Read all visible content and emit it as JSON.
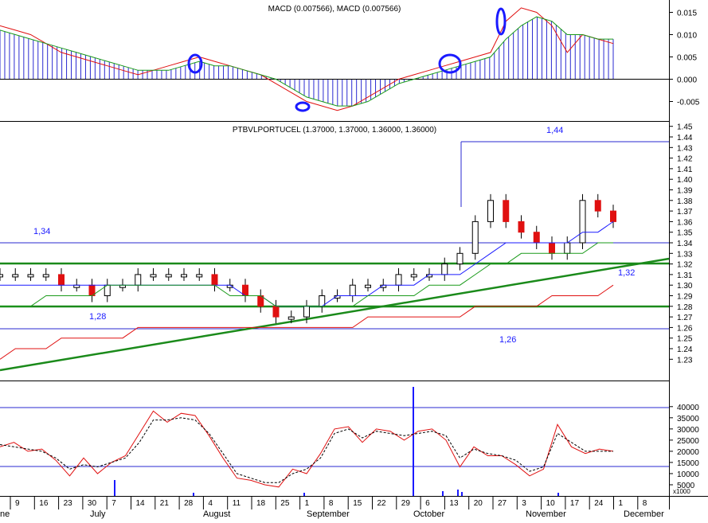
{
  "macd_panel": {
    "title": "MACD (0.007566), MACD (0.007566)",
    "axis_ticks": [
      "0.015",
      "0.010",
      "0.005",
      "0.000",
      "-0.005"
    ]
  },
  "price_panel": {
    "title": "PTBVLPORTUCEL (1.37000, 1.37000, 1.36000, 1.36000)",
    "axis_ticks": [
      "1.45",
      "1.44",
      "1.43",
      "1.42",
      "1.41",
      "1.40",
      "1.39",
      "1.38",
      "1.37",
      "1.36",
      "1.35",
      "1.34",
      "1.33",
      "1.32",
      "1.31",
      "1.30",
      "1.29",
      "1.28",
      "1.27",
      "1.26",
      "1.25",
      "1.24",
      "1.23"
    ],
    "annotations": [
      {
        "text": "1,44",
        "value": 1.44
      },
      {
        "text": "1,34",
        "value": 1.34
      },
      {
        "text": "1,32",
        "value": 1.32
      },
      {
        "text": "1,28",
        "value": 1.28
      },
      {
        "text": "1,26",
        "value": 1.26
      }
    ]
  },
  "volume_panel": {
    "axis_ticks": [
      "40000",
      "35000",
      "30000",
      "25000",
      "20000",
      "15000",
      "10000",
      "5000"
    ],
    "unit": "x1000"
  },
  "x_axis": {
    "day_ticks": [
      "9",
      "16",
      "23",
      "30",
      "7",
      "14",
      "21",
      "28",
      "4",
      "11",
      "18",
      "25",
      "1",
      "8",
      "15",
      "22",
      "29",
      "6",
      "13",
      "20",
      "27",
      "3",
      "10",
      "17",
      "24",
      "1",
      "8"
    ],
    "months": [
      "July",
      "August",
      "September",
      "October",
      "November",
      "December"
    ],
    "partial_month": "ne"
  },
  "chart_data": [
    {
      "type": "line",
      "title": "MACD (0.007566), MACD (0.007566)",
      "ylim": [
        -0.008,
        0.017
      ],
      "x_ticks": [
        "9",
        "16",
        "23",
        "30",
        "7",
        "14",
        "21",
        "28",
        "4",
        "11",
        "18",
        "25",
        "1",
        "8",
        "15",
        "22",
        "29",
        "6",
        "13",
        "20",
        "27",
        "3",
        "10",
        "17",
        "24"
      ],
      "series": [
        {
          "values": [
            0.012,
            0.011,
            0.01,
            0.008,
            0.006,
            0.005,
            0.004,
            0.003,
            0.002,
            0.001,
            0.002,
            0.003,
            0.004,
            0.005,
            0.004,
            0.003,
            0.002,
            0.001,
            -0.001,
            -0.003,
            -0.005,
            -0.006,
            -0.007,
            -0.006,
            -0.004,
            -0.002,
            0.0,
            0.001,
            0.002,
            0.003,
            0.004,
            0.005,
            0.006,
            0.013,
            0.016,
            0.015,
            0.012,
            0.006,
            0.01,
            0.009,
            0.008
          ]
        },
        {
          "values": [
            0.011,
            0.01,
            0.009,
            0.008,
            0.007,
            0.006,
            0.005,
            0.004,
            0.003,
            0.002,
            0.002,
            0.002,
            0.003,
            0.004,
            0.003,
            0.003,
            0.002,
            0.001,
            0.0,
            -0.002,
            -0.004,
            -0.005,
            -0.006,
            -0.006,
            -0.005,
            -0.003,
            -0.001,
            0.0,
            0.001,
            0.002,
            0.003,
            0.004,
            0.005,
            0.009,
            0.012,
            0.014,
            0.013,
            0.01,
            0.01,
            0.009,
            0.009
          ]
        },
        {
          "values": [
            0.012,
            0.011,
            0.01,
            0.009,
            0.008,
            0.007,
            0.005,
            0.004,
            0.003,
            0.002,
            0.001,
            0.002,
            0.003,
            0.004,
            0.004,
            0.003,
            0.002,
            0.001,
            -0.001,
            -0.002,
            -0.004,
            -0.005,
            -0.006,
            -0.007,
            -0.005,
            -0.003,
            -0.001,
            0.0,
            0.001,
            0.002,
            0.003,
            0.004,
            0.006,
            0.009,
            0.012,
            0.014,
            0.012,
            0.009,
            0.009,
            0.009,
            0.008
          ]
        }
      ]
    },
    {
      "type": "line",
      "title": "PTBVLPORTUCEL (1.37000, 1.37000, 1.36000, 1.36000)",
      "ylim": [
        1.22,
        1.46
      ],
      "series": [
        {
          "values": [
            1.31,
            1.31,
            1.31,
            1.31,
            1.3,
            1.3,
            1.29,
            1.3,
            1.3,
            1.31,
            1.31,
            1.31,
            1.31,
            1.31,
            1.3,
            1.3,
            1.29,
            1.28,
            1.27,
            1.27,
            1.28,
            1.29,
            1.29,
            1.3,
            1.3,
            1.3,
            1.31,
            1.31,
            1.31,
            1.32,
            1.33,
            1.36,
            1.38,
            1.36,
            1.35,
            1.34,
            1.33,
            1.34,
            1.38,
            1.37,
            1.36
          ]
        },
        {
          "values": [
            1.3,
            1.3,
            1.3,
            1.3,
            1.3,
            1.3,
            1.3,
            1.3,
            1.3,
            1.3,
            1.3,
            1.3,
            1.3,
            1.3,
            1.3,
            1.3,
            1.29,
            1.29,
            1.28,
            1.28,
            1.28,
            1.28,
            1.29,
            1.29,
            1.29,
            1.3,
            1.3,
            1.3,
            1.31,
            1.31,
            1.31,
            1.32,
            1.33,
            1.34,
            1.34,
            1.34,
            1.34,
            1.34,
            1.35,
            1.35,
            1.36
          ]
        },
        {
          "values": [
            1.28,
            1.28,
            1.28,
            1.29,
            1.29,
            1.29,
            1.29,
            1.3,
            1.3,
            1.3,
            1.3,
            1.3,
            1.3,
            1.3,
            1.3,
            1.29,
            1.29,
            1.29,
            1.28,
            1.28,
            1.28,
            1.28,
            1.28,
            1.28,
            1.29,
            1.29,
            1.29,
            1.29,
            1.3,
            1.3,
            1.3,
            1.31,
            1.32,
            1.32,
            1.33,
            1.33,
            1.33,
            1.33,
            1.33,
            1.34,
            1.34
          ]
        },
        {
          "values": [
            1.23,
            1.24,
            1.24,
            1.24,
            1.25,
            1.25,
            1.25,
            1.25,
            1.25,
            1.26,
            1.26,
            1.26,
            1.26,
            1.26,
            1.26,
            1.26,
            1.26,
            1.26,
            1.26,
            1.26,
            1.26,
            1.26,
            1.26,
            1.26,
            1.27,
            1.27,
            1.27,
            1.27,
            1.27,
            1.27,
            1.27,
            1.28,
            1.28,
            1.28,
            1.28,
            1.28,
            1.29,
            1.29,
            1.29,
            1.29,
            1.3
          ]
        }
      ]
    },
    {
      "type": "line",
      "ylim": [
        0,
        42000
      ],
      "series": [
        {
          "values": [
            22000,
            24000,
            20000,
            21000,
            16000,
            9000,
            17000,
            10000,
            15000,
            18000,
            28000,
            38000,
            33000,
            37000,
            36000,
            27000,
            17000,
            8000,
            7000,
            5000,
            4000,
            12000,
            10000,
            19000,
            30000,
            31000,
            24000,
            30000,
            29000,
            25000,
            29000,
            30000,
            25000,
            13000,
            22000,
            18000,
            18000,
            14000,
            9000,
            12000,
            32000,
            22000,
            19000,
            21000,
            20000
          ]
        },
        {
          "values": [
            23000,
            22000,
            21000,
            20000,
            17000,
            12000,
            14000,
            13000,
            15000,
            17000,
            24000,
            34000,
            34000,
            35000,
            34000,
            28000,
            19000,
            10000,
            8000,
            6000,
            6000,
            10000,
            12000,
            17000,
            28000,
            30000,
            26000,
            29000,
            28000,
            27000,
            28000,
            29000,
            27000,
            17000,
            21000,
            19000,
            18000,
            16000,
            11000,
            13000,
            28000,
            24000,
            20000,
            20000,
            20000
          ]
        }
      ]
    }
  ]
}
